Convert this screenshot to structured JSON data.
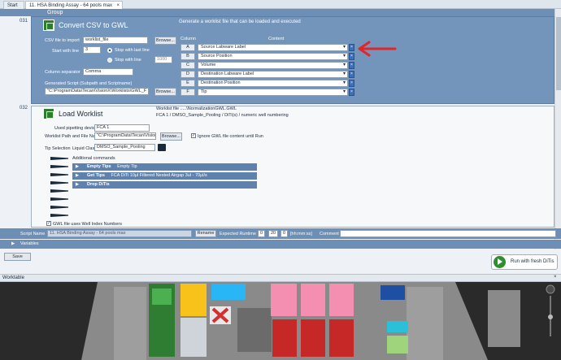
{
  "tabs": {
    "start": "Start",
    "assay": "11. HSA Binding Assay - 64 pools max",
    "close": "×"
  },
  "group": {
    "label": "Group",
    "line_a": "031",
    "line_b": "032"
  },
  "convert_csv": {
    "title": "Convert CSV to GWL",
    "description": "Generate a worklist file that can be loaded and executed",
    "csv_label": "CSV file to import",
    "csv_value": "worklist_file",
    "browse": "Browse...",
    "start_label": "Start with line",
    "start_value": "3",
    "stop_last": "Stop with last line",
    "stop_line": "Stop with line",
    "stop_line_value": "1000",
    "sep_label": "Column separator",
    "sep_value": "Comma",
    "gen_label": "Generated Script (Subpath and Scriptname)",
    "gen_value": "\"C:\\ProgramData\\Tecan\\VisionX\\Worklists\\GWL_F",
    "col_header": "Column",
    "content_header": "Content",
    "columns": [
      {
        "letter": "A",
        "content": "Source Labware Label"
      },
      {
        "letter": "B",
        "content": "Source Position"
      },
      {
        "letter": "C",
        "content": "Volume"
      },
      {
        "letter": "D",
        "content": "Destination Labware Label"
      },
      {
        "letter": "E",
        "content": "Destination Position"
      },
      {
        "letter": "F",
        "content": "Tip"
      }
    ]
  },
  "load_worklist": {
    "title": "Load Worklist",
    "desc1": "Worklist file .....\\NormalizationGWL.GWL",
    "desc2": "FCA 1 / DMSO_Sample_Pooling / DiTi(s) / numeric well numbering",
    "device_label": "Used pipetting device",
    "device_value": "FCA 1",
    "path_label": "Worklist Path and File Name",
    "path_value": "\"C:\\ProgramData\\Tecan\\VisionX\\W",
    "browse": "Browse...",
    "ignore_label": "Ignore GWL file content until Run",
    "tip_label": "Tip Selection",
    "liquid_label": "Liquid Class",
    "liquid_value": "DMSO_Sample_Pooling",
    "additional": "Additional commands",
    "commands": [
      {
        "name": "Empty Tips",
        "extra": "Empty Tip"
      },
      {
        "name": "Get Tips",
        "extra": "FCA DiTi 10μl Filtered Nested    Airgap 3ul - 70μl/s"
      },
      {
        "name": "Drop DiTis",
        "extra": ""
      }
    ],
    "well_index": "GWL file uses Well Index Numbers"
  },
  "script_bar": {
    "label": "Script Name",
    "value": "11. HSA Binding Assay - 64 pools max",
    "rename": "Rename",
    "runtime_label": "Expected Runtime",
    "h": "0",
    "m": "20",
    "s": "0",
    "fmt": "[hh:mm:ss]",
    "comment": "Comment"
  },
  "variables": "Variables",
  "save": "Save",
  "run": "Run with fresh DiTis",
  "worktable": {
    "title": "Worktable",
    "close": "×"
  },
  "colors": {
    "panel": "#7495bb",
    "bar": "#6d8fb6",
    "arrow": "#e0262a"
  }
}
